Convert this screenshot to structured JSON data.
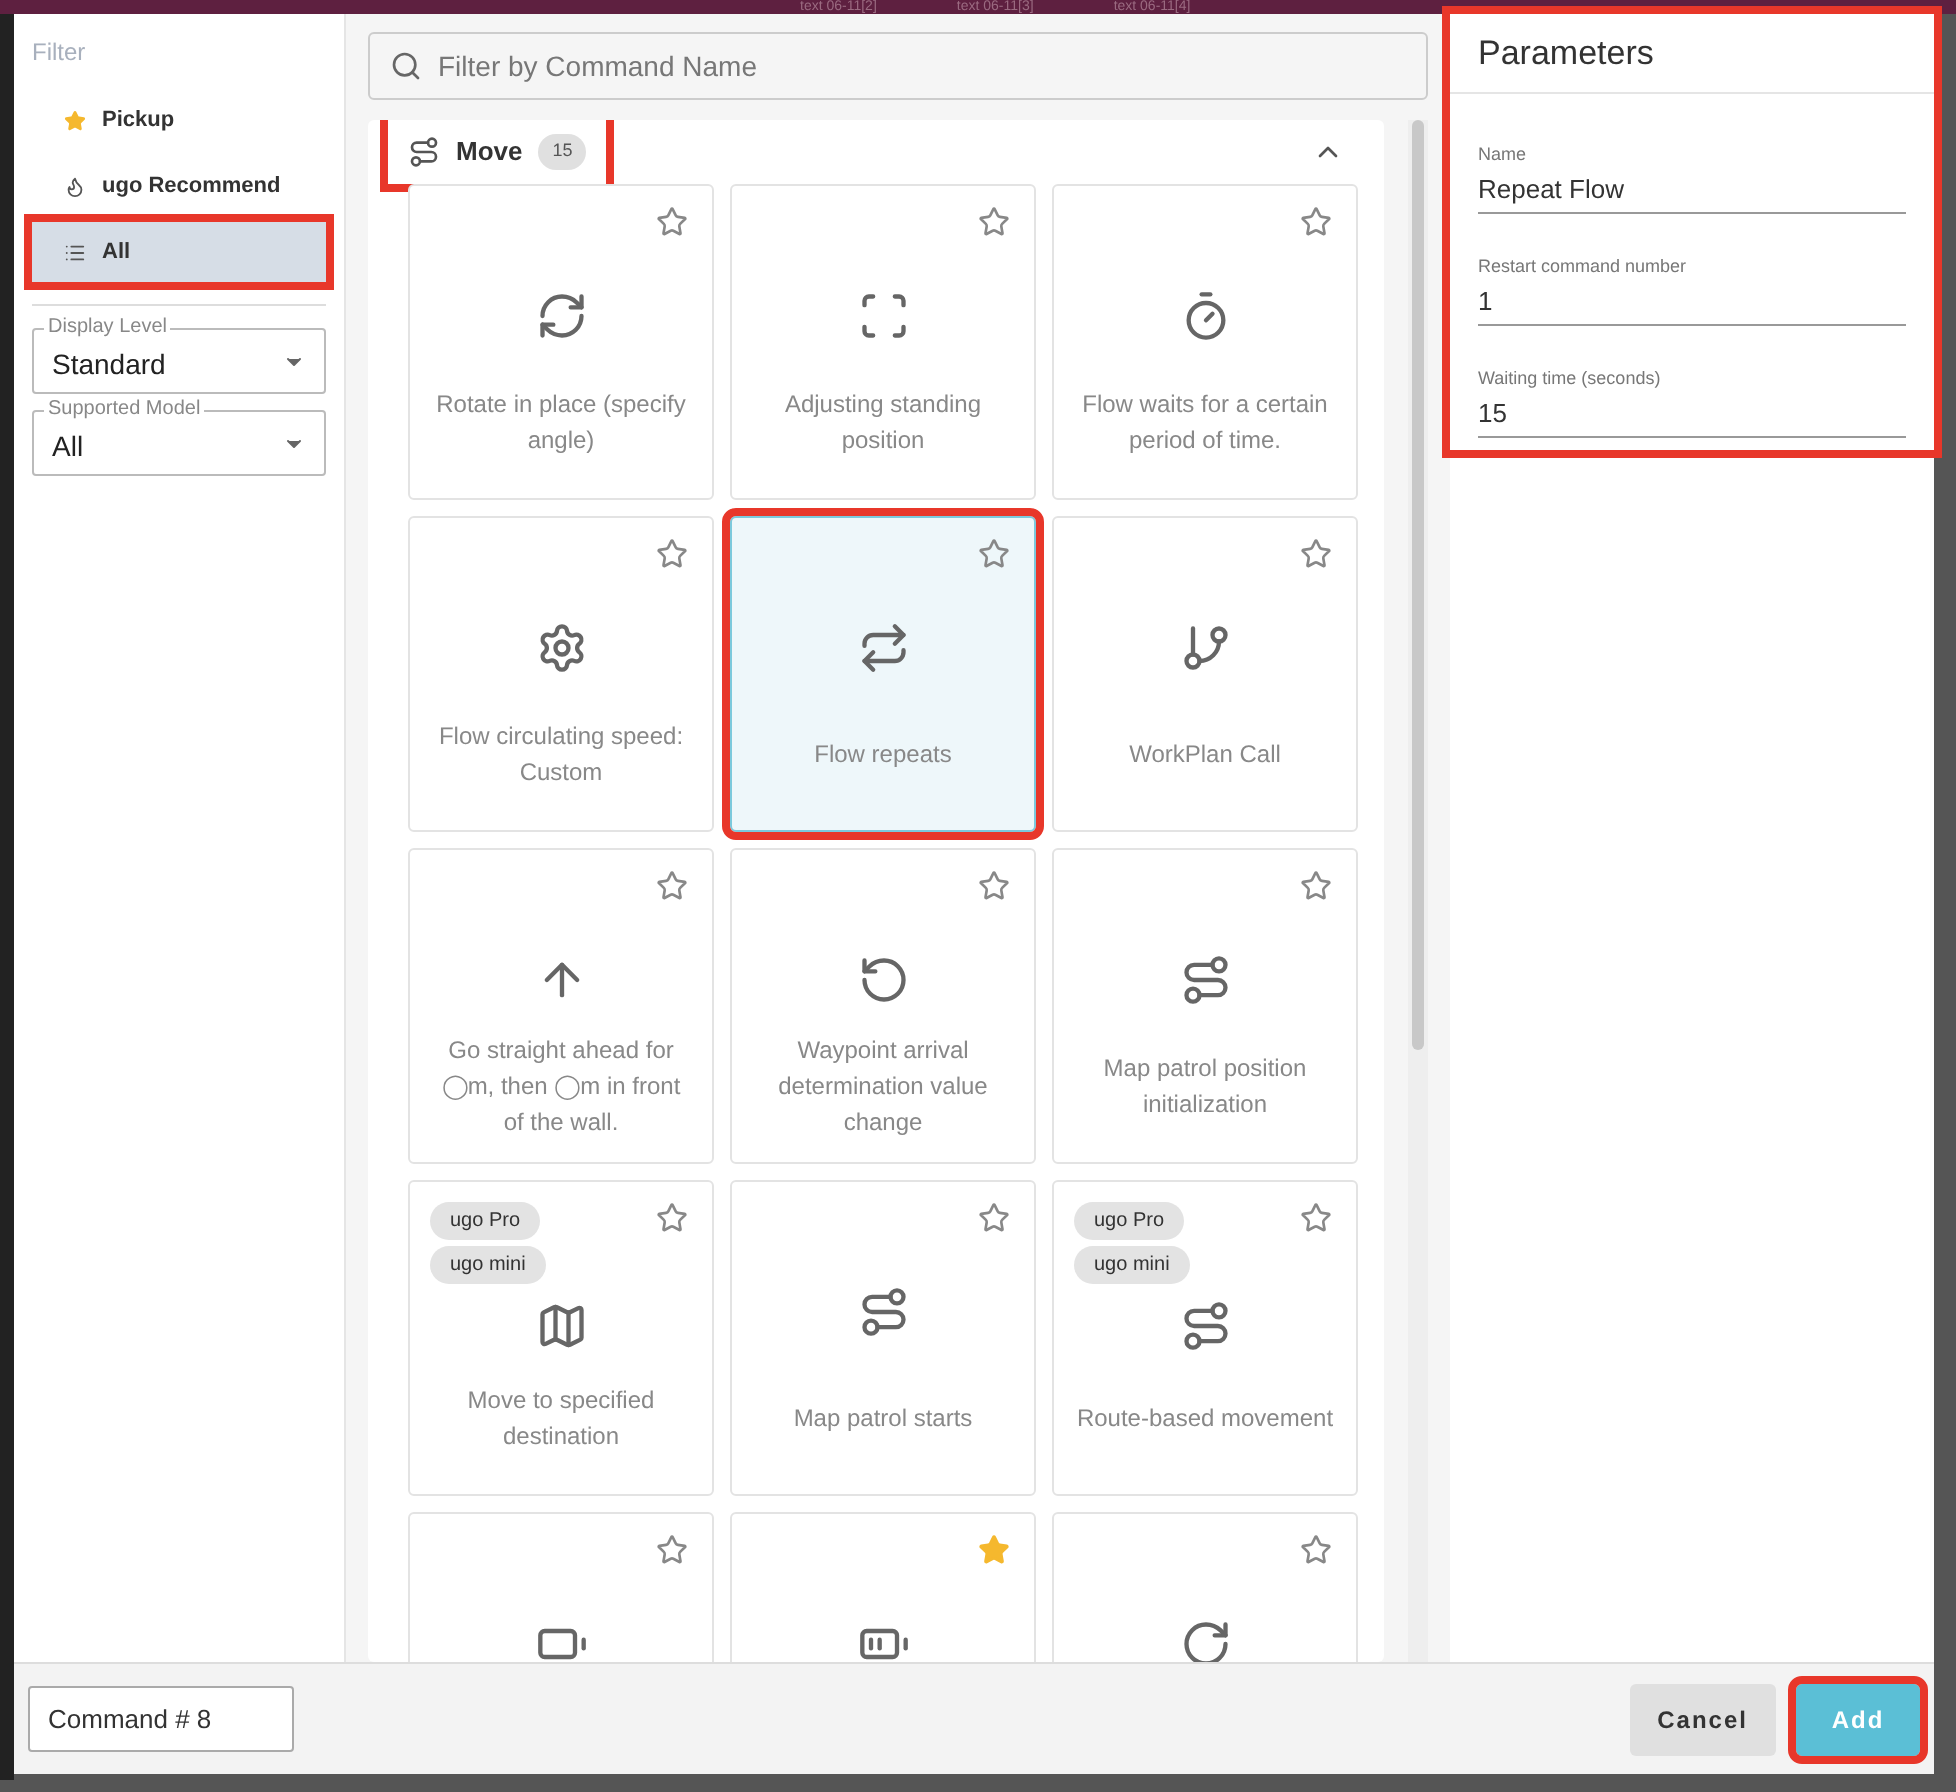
{
  "background_tabs": [
    "text 06-11[2]",
    "text 06-11[3]",
    "text 06-11[4]"
  ],
  "sidebar": {
    "title": "Filter",
    "items": [
      {
        "label": "Pickup",
        "kind": "star",
        "selected": false,
        "highlighted": false
      },
      {
        "label": "ugo Recommend",
        "kind": "flame",
        "selected": false,
        "highlighted": false
      },
      {
        "label": "All",
        "kind": "list",
        "selected": true,
        "highlighted": true
      }
    ],
    "selects": [
      {
        "label": "Display Level",
        "value": "Standard"
      },
      {
        "label": "Supported Model",
        "value": "All"
      }
    ]
  },
  "search": {
    "placeholder": "Filter by Command Name"
  },
  "section": {
    "title": "Move",
    "count": "15",
    "expanded": true,
    "highlighted": true,
    "cards": [
      {
        "label": "Rotate in place (specify angle)",
        "favorite": false,
        "selected": false,
        "highlighted": false
      },
      {
        "label": "Adjusting standing position",
        "favorite": false,
        "selected": false,
        "highlighted": false
      },
      {
        "label": "Flow waits for a certain period of time.",
        "favorite": false,
        "selected": false,
        "highlighted": false
      },
      {
        "label": "Flow circulating speed: Custom",
        "favorite": false,
        "selected": false,
        "highlighted": false
      },
      {
        "label": "Flow repeats",
        "favorite": false,
        "selected": true,
        "highlighted": true
      },
      {
        "label": "WorkPlan Call",
        "favorite": false,
        "selected": false,
        "highlighted": false
      },
      {
        "label": "Go straight ahead for ◯m, then ◯m in front of the wall.",
        "favorite": false,
        "selected": false,
        "highlighted": false
      },
      {
        "label": "Waypoint arrival determination value change",
        "favorite": false,
        "selected": false,
        "highlighted": false
      },
      {
        "label": "Map patrol position initialization",
        "favorite": false,
        "selected": false,
        "highlighted": false
      },
      {
        "label": "Move to specified destination",
        "favorite": false,
        "selected": false,
        "highlighted": false,
        "tags": [
          "ugo Pro",
          "ugo mini"
        ]
      },
      {
        "label": "Map patrol starts",
        "favorite": false,
        "selected": false,
        "highlighted": false
      },
      {
        "label": "Route-based movement",
        "favorite": false,
        "selected": false,
        "highlighted": false,
        "tags": [
          "ugo Pro",
          "ugo mini"
        ]
      },
      {
        "favorite": false,
        "selected": false,
        "highlighted": false
      },
      {
        "favorite": true,
        "selected": false,
        "highlighted": false
      },
      {
        "favorite": false,
        "selected": false,
        "highlighted": false
      }
    ]
  },
  "parameters": {
    "title": "Parameters",
    "highlighted": true,
    "fields": [
      {
        "label": "Name",
        "value": "Repeat Flow"
      },
      {
        "label": "Restart command number",
        "value": "1"
      },
      {
        "label": "Waiting time (seconds)",
        "value": "15"
      }
    ]
  },
  "footer": {
    "command_field": "Command # 8",
    "buttons": [
      {
        "label": "Cancel",
        "kind": "secondary",
        "highlighted": false
      },
      {
        "label": "Add",
        "kind": "primary",
        "highlighted": true
      }
    ]
  }
}
